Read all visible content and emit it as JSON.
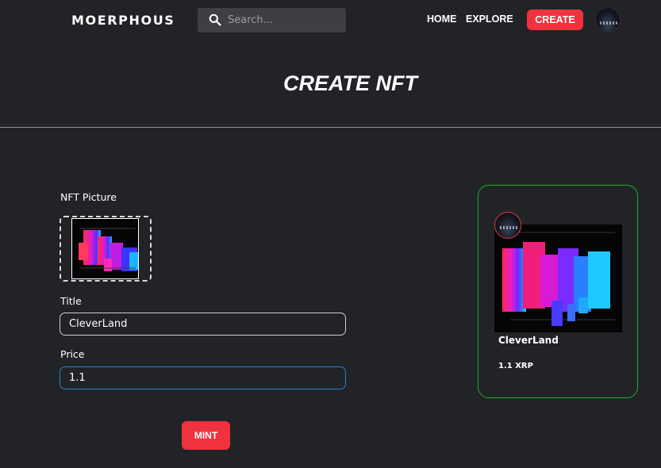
{
  "nav": {
    "brand": "MOERPHOUS",
    "search_placeholder": "Search...",
    "links": [
      "HOME",
      "EXPLORE"
    ],
    "create_label": "CREATE",
    "search_icon": "search-icon",
    "accent_color": "#f0323e"
  },
  "hero": {
    "title": "CREATE NFT"
  },
  "form": {
    "picture_label": "NFT Picture",
    "title_label": "Title",
    "title_value": "CleverLand",
    "price_label": "Price",
    "price_value": "1.1",
    "mint_label": "MINT"
  },
  "preview": {
    "name": "CleverLand",
    "price": "1.1 XRP",
    "border_color": "#1db31d"
  }
}
